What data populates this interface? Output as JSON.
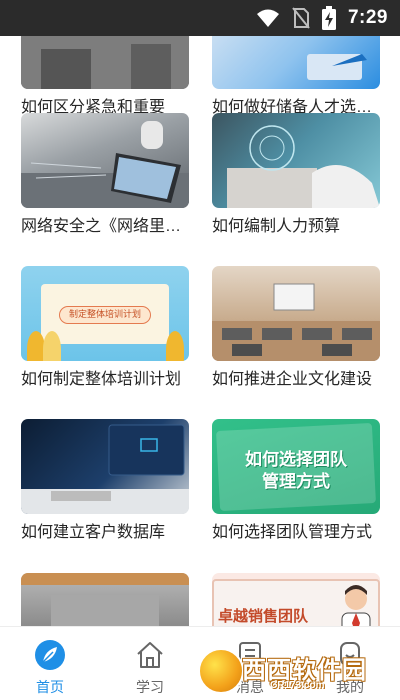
{
  "status_bar": {
    "time": "7:29",
    "icons": [
      "wifi-icon",
      "no-sim-icon",
      "battery-charging-icon"
    ]
  },
  "feed": {
    "cards": [
      {
        "title": "如何区分紧急和重要",
        "thumbnail": "office-desk"
      },
      {
        "title": "如何做好储备人才选…",
        "thumbnail": "laptop-blue"
      },
      {
        "title": "网络安全之《网络里…",
        "thumbnail": "network-tablet"
      },
      {
        "title": "如何编制人力预算",
        "thumbnail": "typing-laptop"
      },
      {
        "title": "如何制定整体培训计划",
        "thumbnail": "training-plan",
        "thumb_text": "制定整体培训计划"
      },
      {
        "title": "如何推进企业文化建设",
        "thumbnail": "classroom"
      },
      {
        "title": "如何建立客户数据库",
        "thumbnail": "data-computer"
      },
      {
        "title": "如何选择团队管理方式",
        "thumbnail": "team-management",
        "thumb_text_line1": "如何选择团队",
        "thumb_text_line2": "管理方式"
      },
      {
        "title": "",
        "thumbnail": "office-desk"
      },
      {
        "title": "",
        "thumbnail": "sales-team",
        "thumb_text": "卓越销售团队"
      }
    ]
  },
  "bottom_nav": {
    "items": [
      {
        "label": "首页",
        "icon": "compass-leaf-icon",
        "active": true
      },
      {
        "label": "学习",
        "icon": "home-icon",
        "active": false
      },
      {
        "label": "消息",
        "icon": "message-icon",
        "active": false
      },
      {
        "label": "我的",
        "icon": "profile-icon",
        "active": false
      }
    ],
    "active_color": "#1f8fe6",
    "inactive_color": "#666666"
  },
  "watermark": {
    "text": "西西软件园",
    "subtext": "CR173.com"
  }
}
